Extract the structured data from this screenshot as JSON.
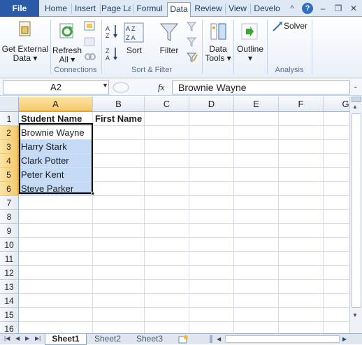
{
  "ribbon_tabs": [
    "File",
    "Home",
    "Insert",
    "Page La",
    "Formul",
    "Data",
    "Review",
    "View",
    "Develo"
  ],
  "ribbon": {
    "get_external": "Get External",
    "data_dd": "Data ▾",
    "refresh": "Refresh",
    "all_dd": "All ▾",
    "sort": "Sort",
    "filter": "Filter",
    "data_tools_1": "Data",
    "data_tools_2": "Tools ▾",
    "outline": "Outline",
    "solver": "Solver",
    "groups": {
      "connections": "Connections",
      "sort_filter": "Sort & Filter",
      "analysis": "Analysis"
    }
  },
  "formula_bar": {
    "name_box": "A2",
    "fx": "fx",
    "value": "Brownie Wayne"
  },
  "columns": [
    "A",
    "B",
    "C",
    "D",
    "E",
    "F",
    "G"
  ],
  "rows": [
    "1",
    "2",
    "3",
    "4",
    "5",
    "6",
    "7",
    "8",
    "9",
    "10",
    "11",
    "12",
    "13",
    "14",
    "15",
    "16"
  ],
  "cells": {
    "a1": "Student Name",
    "b1": "First Name",
    "a2": "Brownie Wayne",
    "a3": "Harry Stark",
    "a4": "Clark Potter",
    "a5": "Peter Kent",
    "a6": "Steve Parker"
  },
  "sheet_tabs": [
    "Sheet1",
    "Sheet2",
    "Sheet3"
  ],
  "colors": {
    "accent": "#2a5aa8",
    "selection": "#c5dbf5",
    "header_selected": "#f6c96a"
  }
}
